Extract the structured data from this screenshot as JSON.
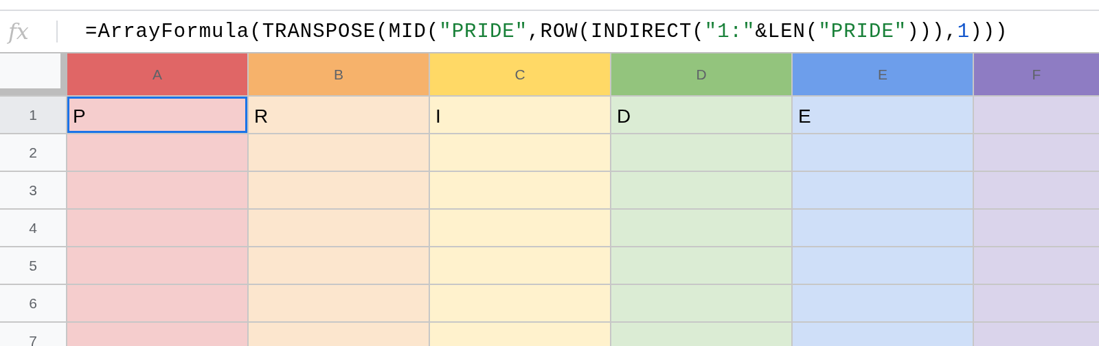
{
  "formula_bar": {
    "label": "fx",
    "formula": [
      {
        "kind": "plain",
        "text": "=ArrayFormula(TRANSPOSE(MID("
      },
      {
        "kind": "string",
        "text": "\"PRIDE\""
      },
      {
        "kind": "plain",
        "text": ",ROW(INDIRECT("
      },
      {
        "kind": "string",
        "text": "\"1:\""
      },
      {
        "kind": "plain",
        "text": "&LEN("
      },
      {
        "kind": "string",
        "text": "\"PRIDE\""
      },
      {
        "kind": "plain",
        "text": "))),"
      },
      {
        "kind": "number",
        "text": "1"
      },
      {
        "kind": "plain",
        "text": ")))"
      }
    ]
  },
  "columns": [
    {
      "label": "A",
      "color": "#e06666"
    },
    {
      "label": "B",
      "color": "#f6b26b"
    },
    {
      "label": "C",
      "color": "#ffd966"
    },
    {
      "label": "D",
      "color": "#93c47d"
    },
    {
      "label": "E",
      "color": "#6d9eeb"
    },
    {
      "label": "F",
      "color": "#8e7cc3"
    }
  ],
  "rows": [
    {
      "number": "1",
      "selected": true,
      "cells": [
        {
          "value": "P",
          "selected": true
        },
        {
          "value": "R",
          "selected": false
        },
        {
          "value": "I",
          "selected": false
        },
        {
          "value": "D",
          "selected": false
        },
        {
          "value": "E",
          "selected": false
        }
      ]
    },
    {
      "number": "2",
      "selected": false
    },
    {
      "number": "3",
      "selected": false
    },
    {
      "number": "4",
      "selected": false
    },
    {
      "number": "5",
      "selected": false
    },
    {
      "number": "6",
      "selected": false
    },
    {
      "number": "7",
      "selected": false
    }
  ]
}
